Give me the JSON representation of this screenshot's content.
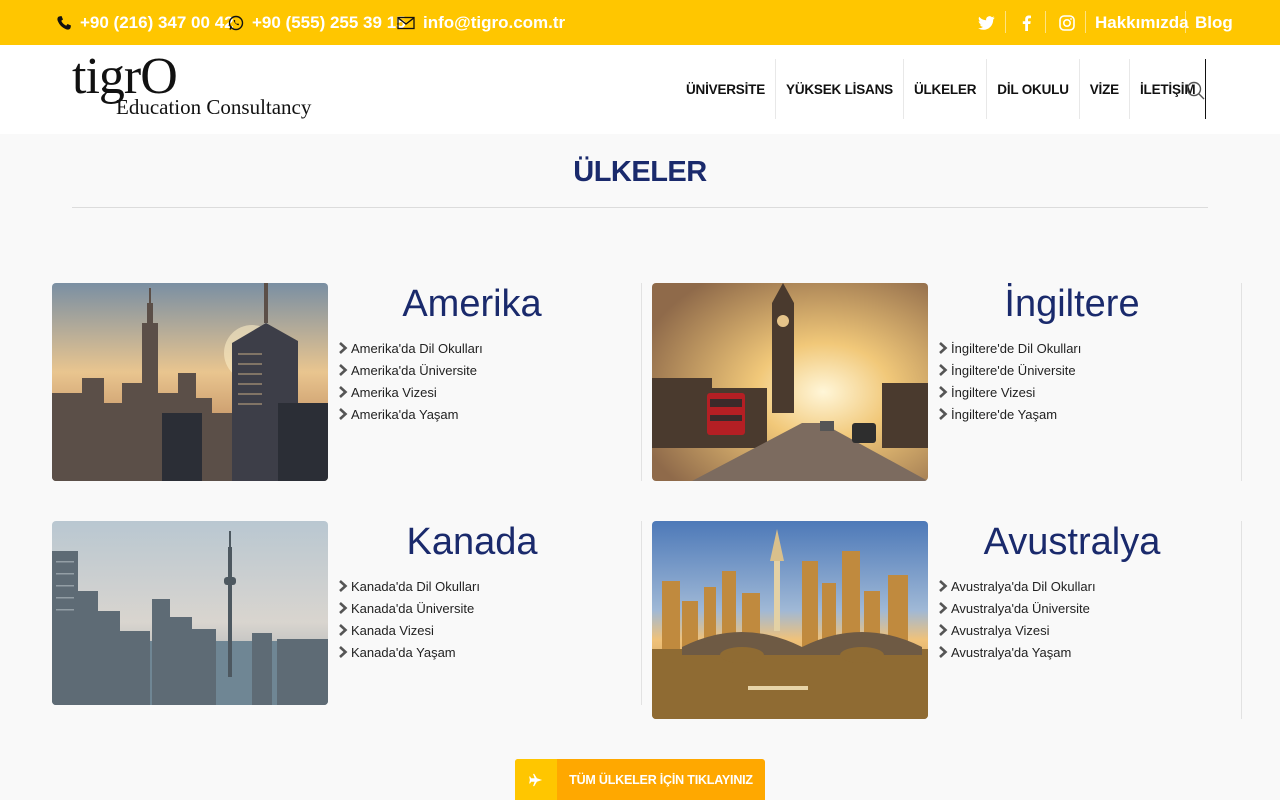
{
  "topbar": {
    "phone1": "+90 (216) 347 00 42",
    "phone2": "+90 (555) 255 39 15",
    "email": "info@tigro.com.tr",
    "social_icons": [
      "twitter-icon",
      "facebook-icon",
      "instagram-icon"
    ],
    "links": [
      "Hakkımızda",
      "Blog"
    ]
  },
  "brand": {
    "logo_main": "tigrO",
    "logo_sub": "Education Consultancy"
  },
  "nav": {
    "items": [
      "ÜNİVERSİTE",
      "YÜKSEK LİSANS",
      "ÜLKELER",
      "DİL OKULU",
      "VİZE",
      "İLETİŞİM"
    ]
  },
  "page": {
    "title": "ÜLKELER"
  },
  "countries": [
    {
      "name": "Amerika",
      "links": [
        "Amerika'da Dil Okulları",
        "Amerika'da Üniversite",
        "Amerika Vizesi",
        "Amerika'da Yaşam"
      ]
    },
    {
      "name": "İngiltere",
      "links": [
        "İngiltere'de Dil Okulları",
        "İngiltere'de Üniversite",
        "İngiltere Vizesi",
        "İngiltere'de Yaşam"
      ]
    },
    {
      "name": "Kanada",
      "links": [
        "Kanada'da Dil Okulları",
        "Kanada'da Üniversite",
        "Kanada Vizesi",
        "Kanada'da Yaşam"
      ]
    },
    {
      "name": "Avustralya",
      "links": [
        "Avustralya'da Dil Okulları",
        "Avustralya'da Üniversite",
        "Avustralya Vizesi",
        "Avustralya'da Yaşam"
      ]
    }
  ],
  "cta": {
    "label": "TÜM ÜLKELER İÇİN TIKLAYINIZ",
    "icon": "airplane-icon"
  },
  "colors": {
    "topbar": "#ffc600",
    "navy": "#1a2a6c",
    "cta": "#ffa800"
  }
}
